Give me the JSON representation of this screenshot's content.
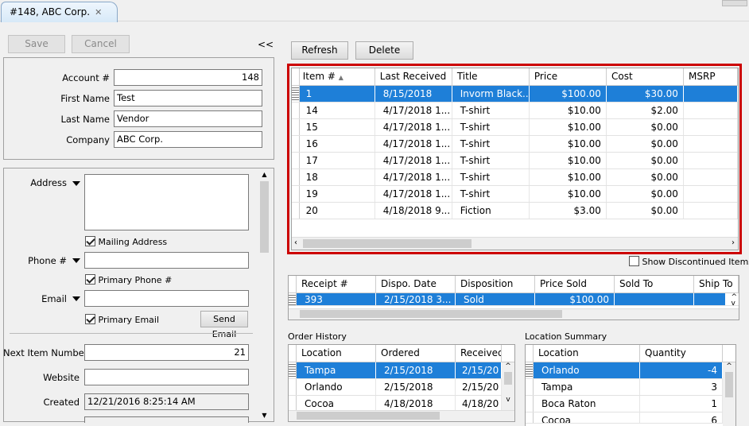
{
  "tab": {
    "title": "#148, ABC Corp.",
    "close": "✕"
  },
  "toolbar": {
    "save": "Save",
    "cancel": "Cancel",
    "collapse": "<<",
    "refresh": "Refresh",
    "delete": "Delete"
  },
  "vendor": {
    "account_label": "Account #",
    "account": "148",
    "first_label": "First Name",
    "first": "Test",
    "last_label": "Last Name",
    "last": "Vendor",
    "company_label": "Company",
    "company": "ABC Corp."
  },
  "contact": {
    "address_label": "Address",
    "mailing_label": "Mailing Address",
    "phone_label": "Phone #",
    "primary_phone_label": "Primary Phone #",
    "email_label": "Email",
    "primary_email_label": "Primary Email",
    "send_email": "Send Email",
    "next_item_label": "Next Item Number",
    "next_item": "21",
    "website_label": "Website",
    "created_label": "Created",
    "created": "12/21/2016 8:25:14 AM"
  },
  "items": {
    "columns": [
      "Item #",
      "Last Received",
      "Title",
      "Price",
      "Cost",
      "MSRP"
    ],
    "rows": [
      [
        "1",
        "8/15/2018",
        "Invorm Black...",
        "$100.00",
        "$30.00",
        ""
      ],
      [
        "14",
        "4/17/2018 1...",
        "T-shirt",
        "$10.00",
        "$2.00",
        ""
      ],
      [
        "15",
        "4/17/2018 1...",
        "T-shirt",
        "$10.00",
        "$0.00",
        ""
      ],
      [
        "16",
        "4/17/2018 1...",
        "T-shirt",
        "$10.00",
        "$0.00",
        ""
      ],
      [
        "17",
        "4/17/2018 1...",
        "T-shirt",
        "$10.00",
        "$0.00",
        ""
      ],
      [
        "18",
        "4/17/2018 1...",
        "T-shirt",
        "$10.00",
        "$0.00",
        ""
      ],
      [
        "19",
        "4/17/2018 1...",
        "T-shirt",
        "$10.00",
        "$0.00",
        ""
      ],
      [
        "20",
        "4/18/2018 9...",
        "Fiction",
        "$3.00",
        "$0.00",
        ""
      ]
    ]
  },
  "show_discontinued": "Show Discontinued Items",
  "receipts": {
    "columns": [
      "Receipt #",
      "Dispo. Date",
      "Disposition",
      "Price Sold",
      "Sold To",
      "Ship To"
    ],
    "rows": [
      [
        "393",
        "2/15/2018 3...",
        "Sold",
        "$100.00",
        "",
        ""
      ]
    ]
  },
  "order_history": {
    "title": "Order History",
    "columns": [
      "Location",
      "Ordered",
      "Received"
    ],
    "rows": [
      [
        "Tampa",
        "2/15/2018",
        "2/15/20"
      ],
      [
        "Orlando",
        "2/15/2018",
        "2/15/20"
      ],
      [
        "Cocoa",
        "4/18/2018",
        "4/18/20"
      ]
    ]
  },
  "location_summary": {
    "title": "Location Summary",
    "columns": [
      "Location",
      "Quantity"
    ],
    "rows": [
      [
        "Orlando",
        "-4"
      ],
      [
        "Tampa",
        "3"
      ],
      [
        "Boca Raton",
        "1"
      ],
      [
        "Cocoa",
        "6"
      ]
    ]
  },
  "colors": {
    "selection": "#1e7fd8",
    "highlight_border": "#cc0000"
  }
}
